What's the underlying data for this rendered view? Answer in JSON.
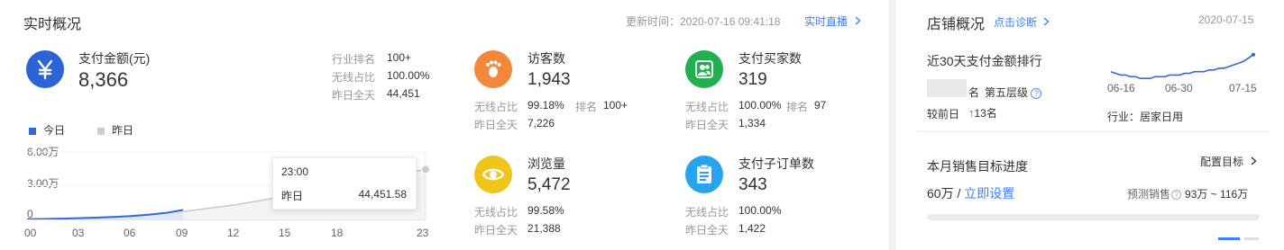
{
  "realtime": {
    "title": "实时概况",
    "update_label": "更新时间：",
    "update_time": "2020-07-16 09:41:18",
    "live_link": "实时直播"
  },
  "payment": {
    "name": "支付金额(元)",
    "value": "8,366",
    "stats": [
      {
        "label": "行业排名",
        "value": "100+"
      },
      {
        "label": "无线占比",
        "value": "100.00%"
      },
      {
        "label": "昨日全天",
        "value": "44,451"
      }
    ]
  },
  "metrics": [
    {
      "name": "访客数",
      "value": "1,943",
      "icon": "footprint-icon",
      "color": "#f4873a",
      "row1_label": "无线占比",
      "row1_value": "99.18%",
      "rank_label": "排名",
      "rank_value": "100+",
      "row2_label": "昨日全天",
      "row2_value": "7,226"
    },
    {
      "name": "支付买家数",
      "value": "319",
      "icon": "users-icon",
      "color": "#21b04b",
      "row1_label": "无线占比",
      "row1_value": "100.00%",
      "rank_label": "排名",
      "rank_value": "97",
      "row2_label": "昨日全天",
      "row2_value": "1,334"
    },
    {
      "name": "浏览量",
      "value": "5,472",
      "icon": "eye-icon",
      "color": "#f0c419",
      "row1_label": "无线占比",
      "row1_value": "99.58%",
      "row2_label": "昨日全天",
      "row2_value": "21,388"
    },
    {
      "name": "支付子订单数",
      "value": "343",
      "icon": "clipboard-icon",
      "color": "#27a4ef",
      "row1_label": "无线占比",
      "row1_value": "100.00%",
      "row2_label": "昨日全天",
      "row2_value": "1,422"
    }
  ],
  "legend": {
    "today": "今日",
    "yesterday": "昨日",
    "today_color": "#3567d6",
    "yesterday_color": "#cccccc"
  },
  "chart_data": {
    "type": "area",
    "x_ticks": [
      "00",
      "03",
      "06",
      "09",
      "12",
      "15",
      "18",
      "23"
    ],
    "y_ticks": [
      "6.00万",
      "3.00万",
      "0"
    ],
    "ylim": [
      0,
      60000
    ],
    "series": [
      {
        "name": "今日",
        "x": [
          0,
          1,
          2,
          3,
          4,
          5,
          6,
          7,
          8,
          9
        ],
        "values": [
          200,
          400,
          700,
          1100,
          1600,
          2200,
          3000,
          4200,
          5800,
          8366
        ]
      },
      {
        "name": "昨日",
        "x": [
          0,
          3,
          6,
          9,
          12,
          15,
          18,
          21,
          23
        ],
        "values": [
          200,
          1200,
          3000,
          7000,
          13000,
          21000,
          30000,
          39000,
          44451
        ]
      }
    ],
    "tooltip": {
      "time": "23:00",
      "label": "昨日",
      "value": "44,451.58"
    }
  },
  "store": {
    "title": "店铺概况",
    "diag_link": "点击诊断",
    "date": "2020-07-15",
    "rank_title": "近30天支付金额排行",
    "rank_suffix": "名",
    "level": "第五层级",
    "vs_label": "较前日",
    "vs_value": "13名",
    "trend_ticks": [
      "06-16",
      "06-30",
      "07-15"
    ],
    "industry": "行业：居家日用",
    "trend_values": [
      62,
      61,
      60,
      60,
      59,
      59,
      58,
      58,
      58,
      59,
      59,
      59,
      60,
      60,
      60,
      61,
      61,
      62,
      62,
      62,
      63,
      63,
      64,
      64,
      65,
      66,
      67,
      68,
      70,
      72
    ],
    "goal_title": "本月销售目标进度",
    "goal_config": "配置目标",
    "goal_value": "60万",
    "goal_sep": "/",
    "goal_link": "立即设置",
    "forecast_label": "预测销售",
    "forecast_value": "93万 ~ 116万",
    "goal_progress": 0
  }
}
